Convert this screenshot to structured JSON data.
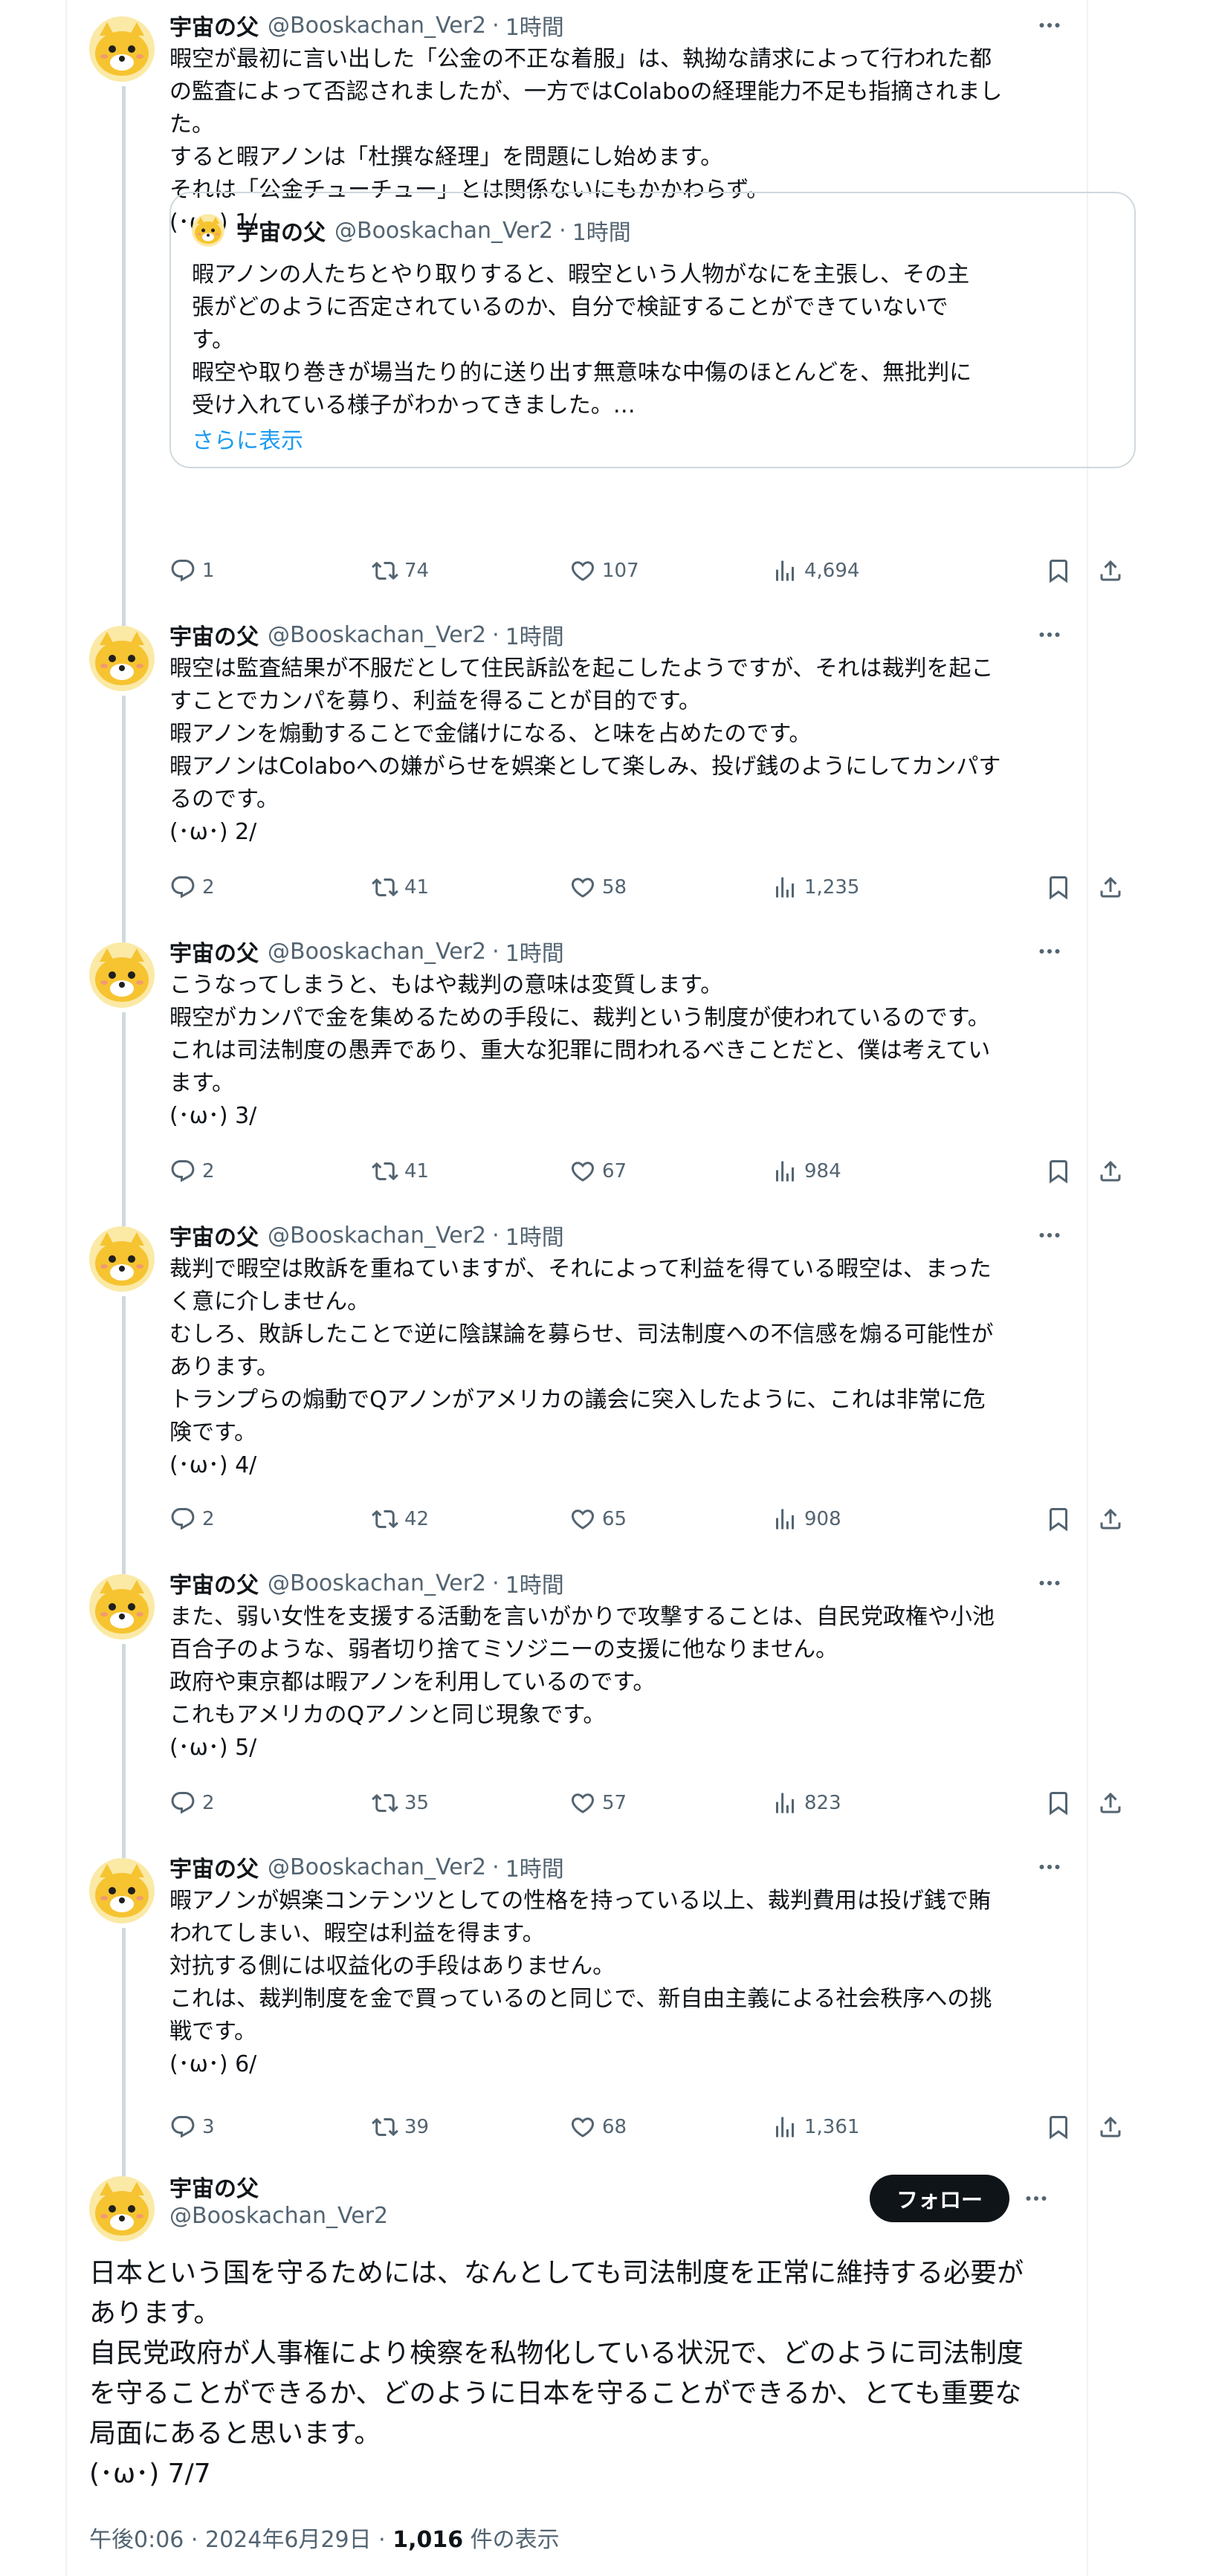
{
  "author": {
    "display_name": "宇宙の父",
    "handle": "@Booskachan_Ver2",
    "avatar_icon": "yellow-character-avatar"
  },
  "dot": "·",
  "time": "1時間",
  "colors": {
    "text": "#0f1419",
    "secondary": "#536471",
    "link": "#1d9bf0",
    "border": "#cfd9de",
    "avatar_yellow": "#f6c431"
  },
  "tweets": [
    {
      "text": "暇空が最初に言い出した「公金の不正な着服」は、執拗な請求によって行われた都\nの監査によって否認されましたが、一方ではColaboの経理能力不足も指摘されまし\nた。\nすると暇アノンは「杜撰な経理」を問題にし始めます。\nそれは「公金チューチュー」とは関係ないにもかかわらず。\n(･ω･) 1/",
      "quote": {
        "text": "暇アノンの人たちとやり取りすると、暇空という人物がなにを主張し、その主\n張がどのように否定されているのか、自分で検証することができていないで\nす。\n暇空や取り巻きが場当たり的に送り出す無意味な中傷のほとんどを、無批判に\n受け入れている様子がわかってきました。…",
        "show_more": "さらに表示"
      },
      "replies": "1",
      "retweets": "74",
      "likes": "107",
      "views": "4,694"
    },
    {
      "text": "暇空は監査結果が不服だとして住民訴訟を起こしたようですが、それは裁判を起こ\nすことでカンパを募り、利益を得ることが目的です。\n暇アノンを煽動することで金儲けになる、と味を占めたのです。\n暇アノンはColaboへの嫌がらせを娯楽として楽しみ、投げ銭のようにしてカンパす\nるのです。\n(･ω･) 2/",
      "replies": "2",
      "retweets": "41",
      "likes": "58",
      "views": "1,235"
    },
    {
      "text": "こうなってしまうと、もはや裁判の意味は変質します。\n暇空がカンパで金を集めるための手段に、裁判という制度が使われているのです。\nこれは司法制度の愚弄であり、重大な犯罪に問われるべきことだと、僕は考えてい\nます。\n(･ω･) 3/",
      "replies": "2",
      "retweets": "41",
      "likes": "67",
      "views": "984"
    },
    {
      "text": "裁判で暇空は敗訴を重ねていますが、それによって利益を得ている暇空は、まった\nく意に介しません。\nむしろ、敗訴したことで逆に陰謀論を募らせ、司法制度への不信感を煽る可能性が\nあります。\nトランプらの煽動でQアノンがアメリカの議会に突入したように、これは非常に危\n険です。\n(･ω･) 4/",
      "replies": "2",
      "retweets": "42",
      "likes": "65",
      "views": "908"
    },
    {
      "text": "また、弱い女性を支援する活動を言いがかりで攻撃することは、自民党政権や小池\n百合子のような、弱者切り捨てミソジニーの支援に他なりません。\n政府や東京都は暇アノンを利用しているのです。\nこれもアメリカのQアノンと同じ現象です。\n(･ω･) 5/",
      "replies": "2",
      "retweets": "35",
      "likes": "57",
      "views": "823"
    },
    {
      "text": "暇アノンが娯楽コンテンツとしての性格を持っている以上、裁判費用は投げ銭で賄\nわれてしまい、暇空は利益を得ます。\n対抗する側には収益化の手段はありません。\nこれは、裁判制度を金で買っているのと同じで、新自由主義による社会秩序への挑\n戦です。\n(･ω･) 6/",
      "replies": "3",
      "retweets": "39",
      "likes": "68",
      "views": "1,361"
    }
  ],
  "main_tweet": {
    "display_name": "宇宙の父",
    "handle": "@Booskachan_Ver2",
    "follow_label": "フォロー",
    "text": "日本という国を守るためには、なんとしても司法制度を正常に維持する必要が\nあります。\n自民党政府が人事権により検察を私物化している状況で、どのように司法制度\nを守ることができるか、どのように日本を守ることができるか、とても重要な\n局面にあると思います。\n(･ω･) 7/7",
    "timestamp": "午後0:06 · 2024年6月29日 · ",
    "view_count": "1,016",
    "view_suffix": " 件の表示"
  }
}
